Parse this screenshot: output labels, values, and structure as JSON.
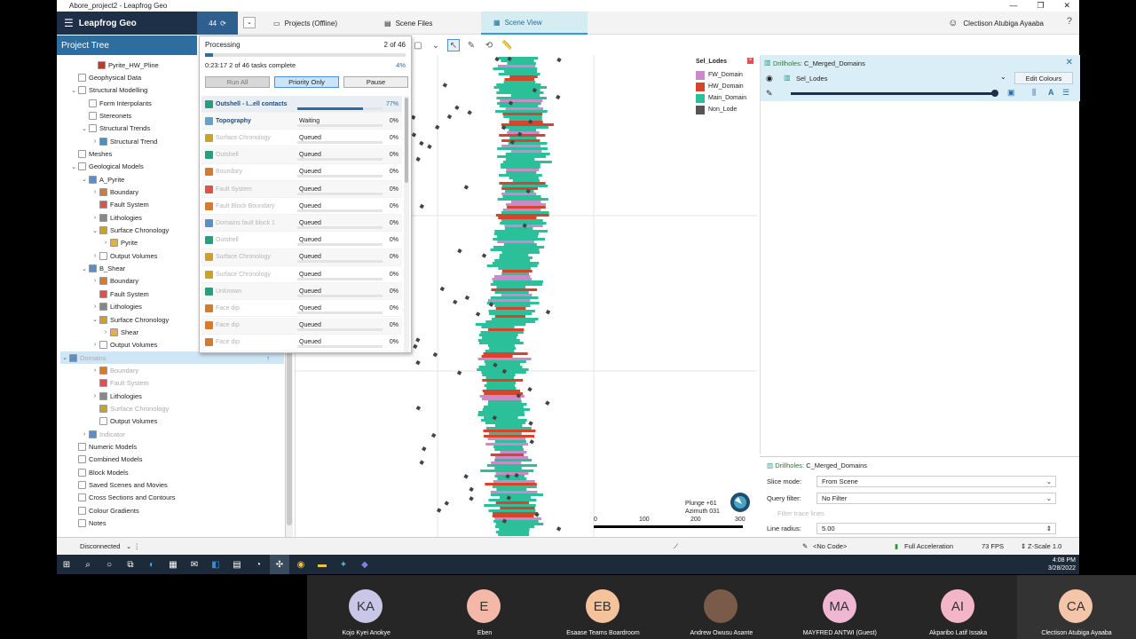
{
  "window": {
    "title": "Abore_project2 - Leapfrog Geo",
    "min": "—",
    "max": "❐",
    "close": "✕"
  },
  "header": {
    "brand": "Leapfrog Geo",
    "task_count": "44",
    "tabs": [
      "Projects (Offline)",
      "Scene Files",
      "Scene View"
    ],
    "user_name": "Clectison Atubiga Ayaaba"
  },
  "project_tree": {
    "title": "Project Tree",
    "rows": [
      {
        "label": "Pyrite_HW_Pline",
        "indent": 30,
        "twisty": "",
        "icon": "#c0392b",
        "dim": false
      },
      {
        "label": "Geophysical Data",
        "indent": 8,
        "twisty": "",
        "icon": "#ffffff",
        "dim": false
      },
      {
        "label": "Structural Modelling",
        "indent": 8,
        "twisty": "⌄",
        "icon": "#ffffff",
        "dim": false
      },
      {
        "label": "Form Interpolants",
        "indent": 20,
        "twisty": "",
        "icon": "#ffffff",
        "dim": false
      },
      {
        "label": "Stereonets",
        "indent": 20,
        "twisty": "",
        "icon": "#ffffff",
        "dim": false
      },
      {
        "label": "Structural Trends",
        "indent": 20,
        "twisty": "⌄",
        "icon": "#ffffff",
        "dim": false
      },
      {
        "label": "Structural Trend",
        "indent": 32,
        "twisty": "›",
        "icon": "#4a90c2",
        "dim": false
      },
      {
        "label": "Meshes",
        "indent": 8,
        "twisty": "",
        "icon": "#ffffff",
        "dim": false
      },
      {
        "label": "Geological Models",
        "indent": 8,
        "twisty": "⌄",
        "icon": "#ffffff",
        "dim": false
      },
      {
        "label": "A_Pyrite",
        "indent": 20,
        "twisty": "⌄",
        "icon": "#5b8fc7",
        "dim": false
      },
      {
        "label": "Boundary",
        "indent": 32,
        "twisty": "›",
        "icon": "#d97a2b",
        "dim": false
      },
      {
        "label": "Fault System",
        "indent": 32,
        "twisty": "",
        "icon": "#d9534f",
        "dim": false
      },
      {
        "label": "Lithologies",
        "indent": 32,
        "twisty": "›",
        "icon": "#888888",
        "dim": false
      },
      {
        "label": "Surface Chronology",
        "indent": 32,
        "twisty": "⌄",
        "icon": "#c9a227",
        "dim": false
      },
      {
        "label": "Pyrite",
        "indent": 44,
        "twisty": "›",
        "icon": "#e0b040",
        "dim": false
      },
      {
        "label": "Output Volumes",
        "indent": 32,
        "twisty": "›",
        "icon": "#ffffff",
        "dim": false
      },
      {
        "label": "B_Shear",
        "indent": 20,
        "twisty": "⌄",
        "icon": "#5b8fc7",
        "dim": false
      },
      {
        "label": "Boundary",
        "indent": 32,
        "twisty": "›",
        "icon": "#d97a2b",
        "dim": false
      },
      {
        "label": "Fault System",
        "indent": 32,
        "twisty": "",
        "icon": "#d9534f",
        "dim": false
      },
      {
        "label": "Lithologies",
        "indent": 32,
        "twisty": "›",
        "icon": "#888888",
        "dim": false
      },
      {
        "label": "Surface Chronology",
        "indent": 32,
        "twisty": "⌄",
        "icon": "#c9a227",
        "dim": false
      },
      {
        "label": "Shear",
        "indent": 44,
        "twisty": "›",
        "icon": "#e0b040",
        "dim": false
      },
      {
        "label": "Output Volumes",
        "indent": 32,
        "twisty": "›",
        "icon": "#ffffff",
        "dim": false
      },
      {
        "label": "Domains",
        "indent": 20,
        "twisty": "⌄",
        "icon": "#5b8fc7",
        "dim": true,
        "selected": true
      },
      {
        "label": "Boundary",
        "indent": 32,
        "twisty": "›",
        "icon": "#d97a2b",
        "dim": true
      },
      {
        "label": "Fault System",
        "indent": 32,
        "twisty": "",
        "icon": "#d9534f",
        "dim": true
      },
      {
        "label": "Lithologies",
        "indent": 32,
        "twisty": "›",
        "icon": "#888888",
        "dim": false
      },
      {
        "label": "Surface Chronology",
        "indent": 32,
        "twisty": "",
        "icon": "#c9a227",
        "dim": true
      },
      {
        "label": "Output Volumes",
        "indent": 32,
        "twisty": "",
        "icon": "#ffffff",
        "dim": false
      },
      {
        "label": "Indicator",
        "indent": 20,
        "twisty": "›",
        "icon": "#5b8fc7",
        "dim": true
      },
      {
        "label": "Numeric Models",
        "indent": 8,
        "twisty": "",
        "icon": "#ffffff",
        "dim": false
      },
      {
        "label": "Combined Models",
        "indent": 8,
        "twisty": "",
        "icon": "#ffffff",
        "dim": false
      },
      {
        "label": "Block Models",
        "indent": 8,
        "twisty": "",
        "icon": "#ffffff",
        "dim": false
      },
      {
        "label": "Saved Scenes and Movies",
        "indent": 8,
        "twisty": "",
        "icon": "#ffffff",
        "dim": false
      },
      {
        "label": "Cross Sections and Contours",
        "indent": 8,
        "twisty": "",
        "icon": "#ffffff",
        "dim": false
      },
      {
        "label": "Colour Gradients",
        "indent": 8,
        "twisty": "",
        "icon": "#ffffff",
        "dim": false
      },
      {
        "label": "Notes",
        "indent": 8,
        "twisty": "",
        "icon": "#ffffff",
        "dim": false
      }
    ]
  },
  "processing": {
    "title": "Processing",
    "count": "2 of 46",
    "info": "0:23:17  2 of 46 tasks complete",
    "percent": "4%",
    "progress": 0.04,
    "buttons": {
      "run_all": "Run All",
      "priority_only": "Priority Only",
      "pause": "Pause"
    },
    "tasks": [
      {
        "name": "Outshell - I...ell contacts",
        "status": "",
        "pct": "77%",
        "progress": 0.77,
        "icon": "#2b9c7c",
        "bold": true,
        "dim": false
      },
      {
        "name": "Topography",
        "status": "Waiting",
        "pct": "0%",
        "progress": 0,
        "icon": "#6aa0c8",
        "bold": true,
        "dim": false
      },
      {
        "name": "Surface Chronology",
        "status": "Queued",
        "pct": "0%",
        "progress": 0,
        "icon": "#c9a227",
        "bold": false,
        "dim": true
      },
      {
        "name": "Outshell",
        "status": "Queued",
        "pct": "0%",
        "progress": 0,
        "icon": "#2b9c7c",
        "bold": false,
        "dim": true
      },
      {
        "name": "Boundary",
        "status": "Queued",
        "pct": "0%",
        "progress": 0,
        "icon": "#d97a2b",
        "bold": false,
        "dim": true
      },
      {
        "name": "Fault System",
        "status": "Queued",
        "pct": "0%",
        "progress": 0,
        "icon": "#d9534f",
        "bold": false,
        "dim": true
      },
      {
        "name": "Fault Block Boundary",
        "status": "Queued",
        "pct": "0%",
        "progress": 0,
        "icon": "#d97a2b",
        "bold": false,
        "dim": true
      },
      {
        "name": "Domains fault block 1",
        "status": "Queued",
        "pct": "0%",
        "progress": 0,
        "icon": "#5b8fc7",
        "bold": false,
        "dim": true
      },
      {
        "name": "Outshell",
        "status": "Queued",
        "pct": "0%",
        "progress": 0,
        "icon": "#2b9c7c",
        "bold": false,
        "dim": true
      },
      {
        "name": "Surface Chronology",
        "status": "Queued",
        "pct": "0%",
        "progress": 0,
        "icon": "#c9a227",
        "bold": false,
        "dim": true
      },
      {
        "name": "Surface Chronology",
        "status": "Queued",
        "pct": "0%",
        "progress": 0,
        "icon": "#c9a227",
        "bold": false,
        "dim": true
      },
      {
        "name": "Unknown",
        "status": "Queued",
        "pct": "0%",
        "progress": 0,
        "icon": "#2b9c7c",
        "bold": false,
        "dim": true
      },
      {
        "name": "Face dip",
        "status": "Queued",
        "pct": "0%",
        "progress": 0,
        "icon": "#d97a2b",
        "bold": false,
        "dim": true
      },
      {
        "name": "Face dip",
        "status": "Queued",
        "pct": "0%",
        "progress": 0,
        "icon": "#d97a2b",
        "bold": false,
        "dim": true
      },
      {
        "name": "Face dip",
        "status": "Queued",
        "pct": "0%",
        "progress": 0,
        "icon": "#d97a2b",
        "bold": false,
        "dim": true
      }
    ]
  },
  "scene": {
    "legend_title": "Sel_Lodes",
    "legend": [
      {
        "label": "FW_Domain",
        "color": "#c98ac9"
      },
      {
        "label": "HW_Domain",
        "color": "#d8432b"
      },
      {
        "label": "Main_Domain",
        "color": "#2bbf9a"
      },
      {
        "label": "Non_Lode",
        "color": "#555555"
      }
    ],
    "plunge": "Plunge +61",
    "azimuth": "Azimuth 031",
    "scale_ticks": [
      "0",
      "100",
      "200",
      "300"
    ]
  },
  "drillholes": {
    "title_prefix": "Drillholes:",
    "title": "C_Merged_Domains",
    "column": "Sel_Lodes",
    "edit_colours": "Edit Colours",
    "opacity": 1.0
  },
  "properties": {
    "title_prefix": "Drillholes:",
    "title": "C_Merged_Domains",
    "slice_mode_label": "Slice mode:",
    "slice_mode": "From Scene",
    "query_filter_label": "Query filter:",
    "query_filter": "No Filter",
    "filter_trace": "Filter trace lines",
    "line_radius_label": "Line radius:",
    "line_radius": "5.00"
  },
  "status": {
    "connection": "Disconnected",
    "code": "<No Code>",
    "accel": "Full Acceleration",
    "fps": "73 FPS",
    "zscale": "Z-Scale 1.0"
  },
  "taskbar": {
    "time": "4:08 PM",
    "date": "3/28/2022"
  },
  "participants": [
    {
      "initials": "KA",
      "name": "Kojo Kyei Anokye",
      "color": "#c9c7e8"
    },
    {
      "initials": "E",
      "name": "Eben",
      "color": "#f4b8a8"
    },
    {
      "initials": "EB",
      "name": "Esaase Teams Boardroom",
      "color": "#f4c29b"
    },
    {
      "initials": "",
      "name": "Andrew Owusu Asante",
      "color": "#7a5a48"
    },
    {
      "initials": "MA",
      "name": "MAYFRED ANTWI (Guest)",
      "color": "#f0b7d3"
    },
    {
      "initials": "AI",
      "name": "Akparibo Latif Issaka",
      "color": "#f2b6c8"
    },
    {
      "initials": "CA",
      "name": "Clectison Atubiga Ayaaba",
      "color": "#f4c5a8"
    }
  ]
}
